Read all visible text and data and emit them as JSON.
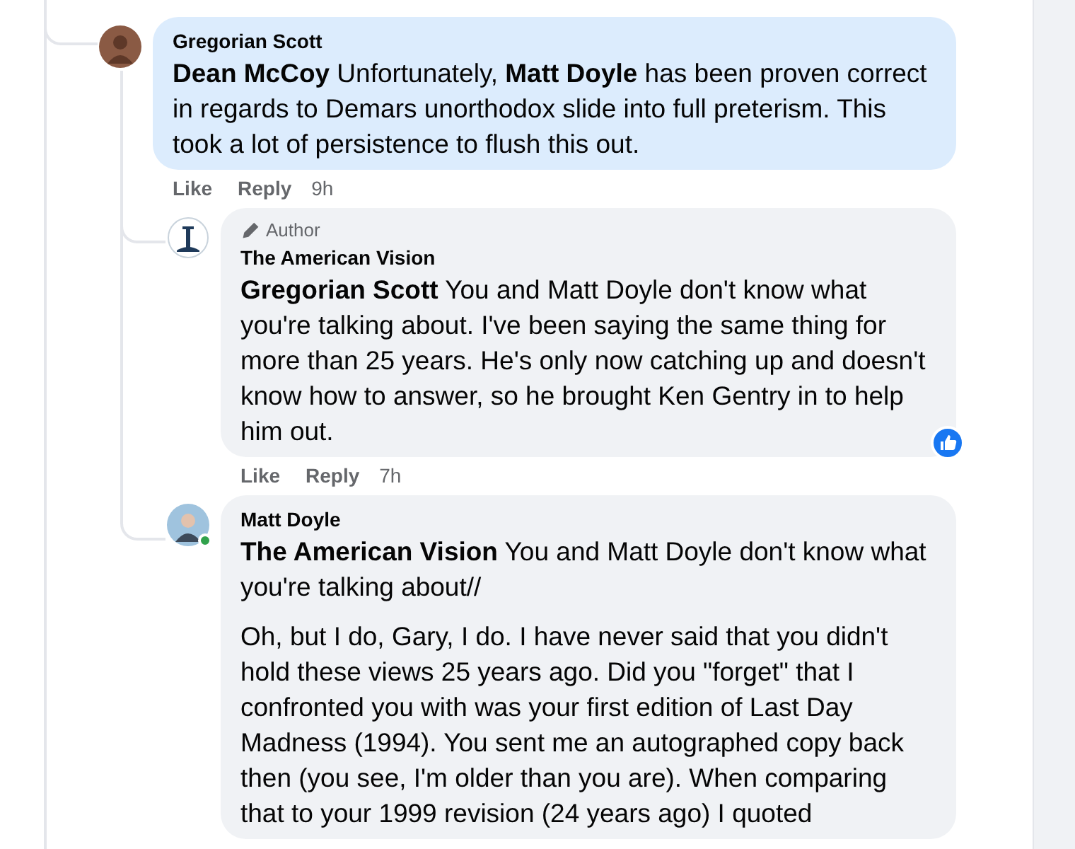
{
  "comments": [
    {
      "author": "Gregorian Scott",
      "avatar": {
        "kind": "photo"
      },
      "online": false,
      "highlighted": true,
      "paragraphs": [
        "**Dean McCoy** Unfortunately, **Matt Doyle** has been proven correct in regards to Demars unorthodox slide into full preterism. This took a lot of persistence to flush this out."
      ],
      "actions": {
        "like": "Like",
        "reply": "Reply",
        "time": "9h"
      },
      "reacted": false
    },
    {
      "author": "The American Vision",
      "avatar": {
        "kind": "logo"
      },
      "online": false,
      "highlighted": false,
      "badge": "Author",
      "paragraphs": [
        "**Gregorian Scott** You and Matt Doyle don't know what you're talking about. I've been saying the same thing for more than 25 years. He's only now catching up and doesn't know how to answer, so he brought Ken Gentry in to help him out."
      ],
      "actions": {
        "like": "Like",
        "reply": "Reply",
        "time": "7h"
      },
      "reacted": true
    },
    {
      "author": "Matt Doyle",
      "avatar": {
        "kind": "photo"
      },
      "online": true,
      "highlighted": false,
      "paragraphs": [
        "**The American Vision** You and Matt Doyle don't know what you're talking about//",
        "Oh, but I do, Gary, I do. I have never said that you didn't hold these views 25 years ago. Did you \"forget\" that I confronted you with was your first edition of Last Day Madness (1994). You sent me an autographed copy back then (you see, I'm older than you are). When comparing that to your 1999 revision (24 years ago) I quoted"
      ],
      "reacted": false
    }
  ]
}
